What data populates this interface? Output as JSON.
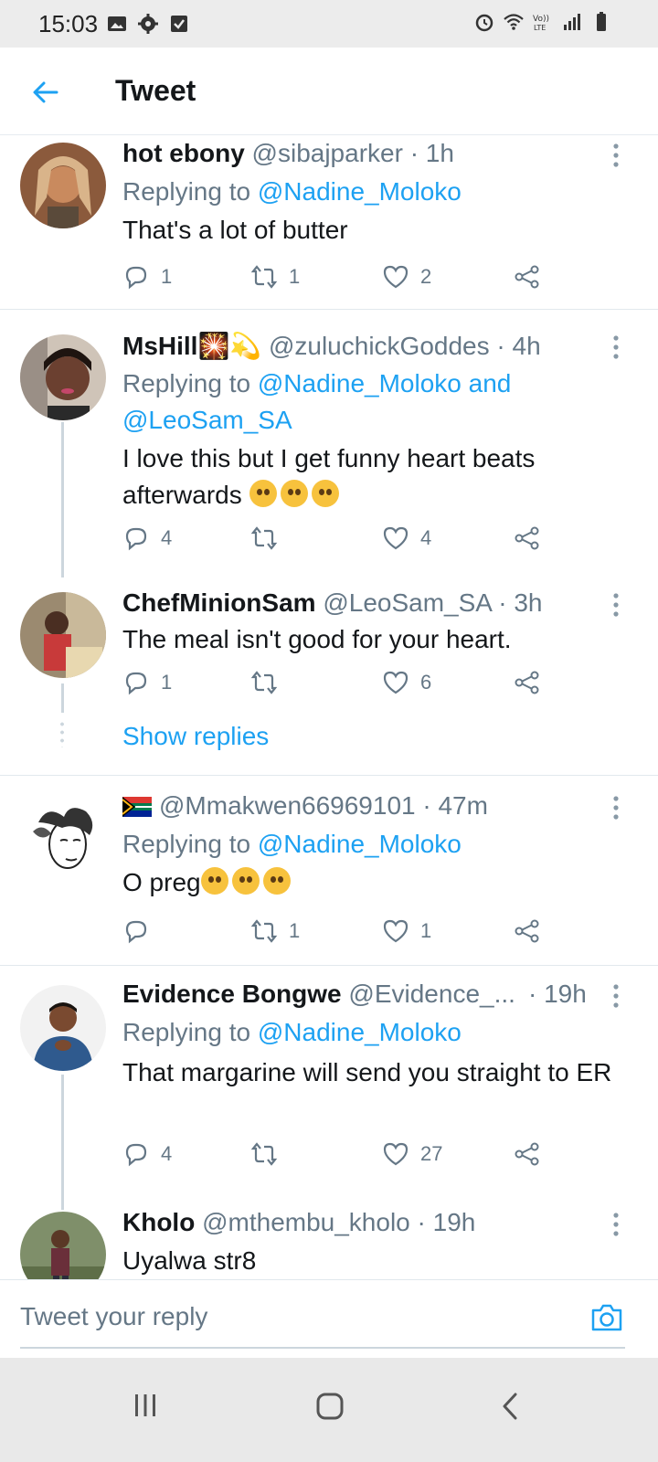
{
  "status_bar": {
    "time": "15:03",
    "left_icons": [
      "image-icon",
      "gear-icon",
      "checkbox-icon"
    ],
    "right_icons": [
      "alarm-icon",
      "wifi-icon",
      "volte-icon",
      "signal-icon",
      "battery-icon"
    ]
  },
  "header": {
    "title": "Tweet",
    "back_icon": "arrow-left-icon"
  },
  "tweets": [
    {
      "name": "hot ebony",
      "handle": "@sibajparker · 1h",
      "replying_prefix": "Replying to ",
      "replying_to": "@Nadine_Moloko",
      "text": "That's a lot of butter",
      "replies": "1",
      "retweets": "1",
      "likes": "2"
    },
    {
      "name": "MsHill🎇💫",
      "handle": "@zuluchickGoddes · 4h",
      "replying_prefix": "Replying to ",
      "replying_to": "@Nadine_Moloko and @LeoSam_SA",
      "text": "I love this but I get funny heart beats afterwards",
      "replies": "4",
      "retweets": "",
      "likes": "4"
    },
    {
      "name": "ChefMinionSam",
      "handle": "@LeoSam_SA · 3h",
      "text": "The meal isn't good for your heart.",
      "replies": "1",
      "retweets": "",
      "likes": "6",
      "show_replies": "Show replies"
    },
    {
      "name": "",
      "handle": "@Mmakwen66969101 · 47m",
      "replying_prefix": "Replying to ",
      "replying_to": "@Nadine_Moloko",
      "text": "O preg",
      "replies": "",
      "retweets": "1",
      "likes": "1"
    },
    {
      "name": "Evidence Bongwe",
      "handle": "@Evidence_...",
      "time": "· 19h",
      "replying_prefix": "Replying to ",
      "replying_to": "@Nadine_Moloko",
      "text": "That margarine will send you straight to ER",
      "replies": "4",
      "retweets": "",
      "likes": "27"
    },
    {
      "name": "Kholo",
      "handle": "@mthembu_kholo · 19h",
      "text": "Uyalwa str8"
    }
  ],
  "reply_bar": {
    "placeholder": "Tweet your reply",
    "camera_icon": "camera-icon"
  },
  "nav_bar": {
    "icons": [
      "recent-apps-icon",
      "home-icon",
      "back-icon"
    ]
  },
  "colors": {
    "accent": "#1da1f2",
    "secondary_text": "#657786",
    "divider": "#e1e8ed"
  }
}
